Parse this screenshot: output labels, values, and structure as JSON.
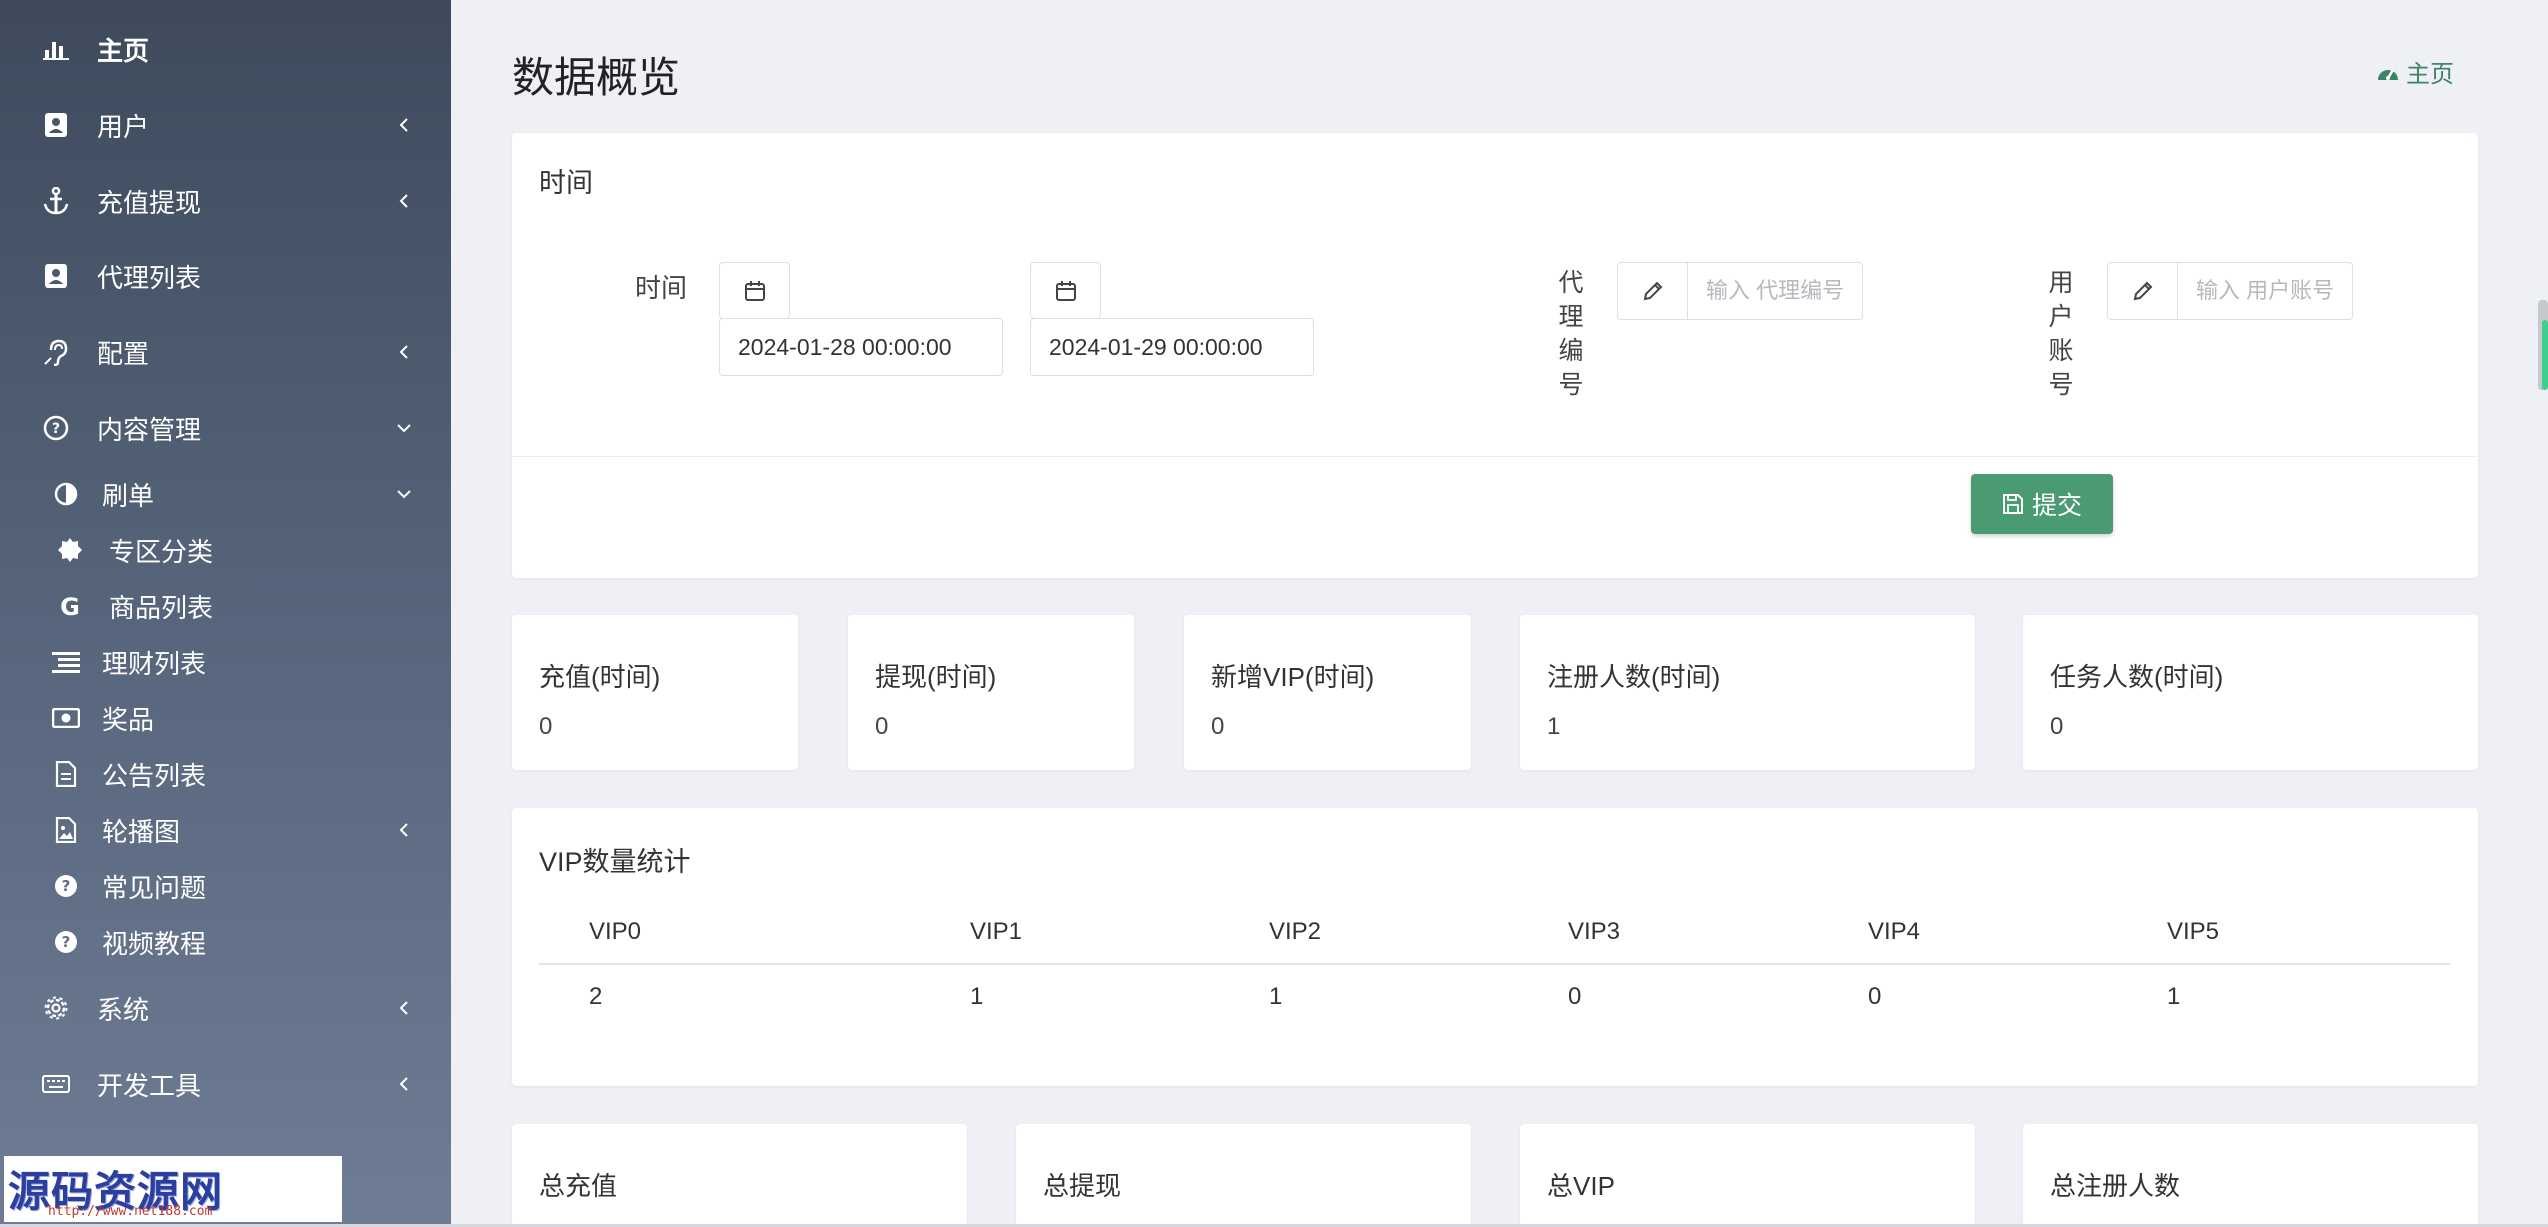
{
  "sidebar": {
    "items": [
      {
        "label": "主页",
        "icon": "bar-chart-icon",
        "chevron": "none"
      },
      {
        "label": "用户",
        "icon": "contact-card-icon",
        "chevron": "left"
      },
      {
        "label": "充值提现",
        "icon": "anchor-icon",
        "chevron": "left"
      },
      {
        "label": "代理列表",
        "icon": "contact-card-icon",
        "chevron": "none"
      },
      {
        "label": "配置",
        "icon": "hearing-icon",
        "chevron": "left"
      },
      {
        "label": "内容管理",
        "icon": "question-circle-icon",
        "chevron": "down"
      },
      {
        "label": "刷单",
        "icon": "half-circle-icon",
        "chevron": "down"
      },
      {
        "label": "专区分类",
        "icon": "badge-icon",
        "chevron": "none"
      },
      {
        "label": "商品列表",
        "icon": "google-icon",
        "chevron": "none"
      },
      {
        "label": "理财列表",
        "icon": "list-icon",
        "chevron": "none"
      },
      {
        "label": "奖品",
        "icon": "money-icon",
        "chevron": "none"
      },
      {
        "label": "公告列表",
        "icon": "document-icon",
        "chevron": "none"
      },
      {
        "label": "轮播图",
        "icon": "image-icon",
        "chevron": "left"
      },
      {
        "label": "常见问题",
        "icon": "question-icon",
        "chevron": "none"
      },
      {
        "label": "视频教程",
        "icon": "question-icon",
        "chevron": "none"
      },
      {
        "label": "系统",
        "icon": "gear-icon",
        "chevron": "left"
      },
      {
        "label": "开发工具",
        "icon": "keyboard-icon",
        "chevron": "left"
      }
    ],
    "watermark": {
      "title": "源码资源网",
      "url": "http://www.net188.com"
    }
  },
  "header": {
    "title": "数据概览",
    "breadcrumb": "主页"
  },
  "filter": {
    "title": "时间",
    "time_label": "时间",
    "start_date": "2024-01-28 00:00:00",
    "end_date": "2024-01-29 00:00:00",
    "agent_label": [
      "代",
      "理",
      "编",
      "号"
    ],
    "agent_placeholder": "输入 代理编号",
    "user_label": [
      "用",
      "户",
      "账",
      "号"
    ],
    "user_placeholder": "输入 用户账号",
    "submit_label": "提交"
  },
  "stats": [
    {
      "title": "充值(时间)",
      "value": "0"
    },
    {
      "title": "提现(时间)",
      "value": "0"
    },
    {
      "title": "新增VIP(时间)",
      "value": "0"
    },
    {
      "title": "注册人数(时间)",
      "value": "1"
    },
    {
      "title": "任务人数(时间)",
      "value": "0"
    }
  ],
  "vip": {
    "title": "VIP数量统计",
    "headers": [
      "VIP0",
      "VIP1",
      "VIP2",
      "VIP3",
      "VIP4",
      "VIP5"
    ],
    "values": [
      "2",
      "1",
      "1",
      "0",
      "0",
      "1"
    ]
  },
  "totals": [
    {
      "title": "总充值"
    },
    {
      "title": "总提现"
    },
    {
      "title": "总VIP"
    },
    {
      "title": "总注册人数"
    }
  ],
  "colors": {
    "accent": "#4a9a72",
    "breadcrumb": "#3b8466",
    "sidebar_top": "#3e4a5c",
    "sidebar_bottom": "#6e7d94"
  }
}
